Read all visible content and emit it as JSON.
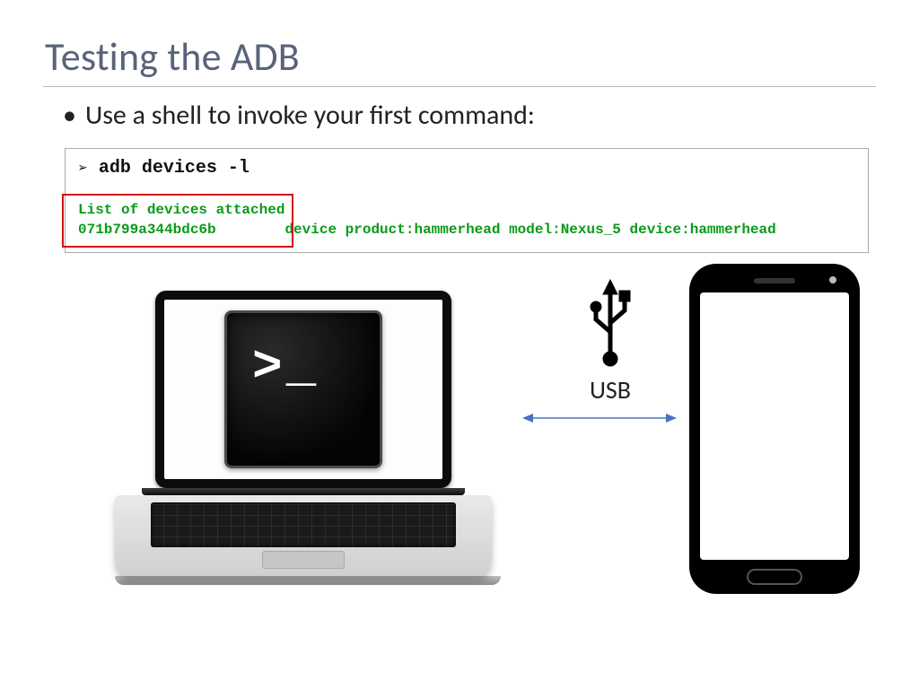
{
  "title": "Testing the ADB",
  "bullet": "Use a shell to invoke your first command:",
  "command": "adb devices -l",
  "output_line1": "List of devices attached",
  "output_line2": "071b799a344bdc6b        device product:hammerhead model:Nexus_5 device:hammerhead",
  "usb_label": "USB",
  "terminal_prompt": ">_"
}
